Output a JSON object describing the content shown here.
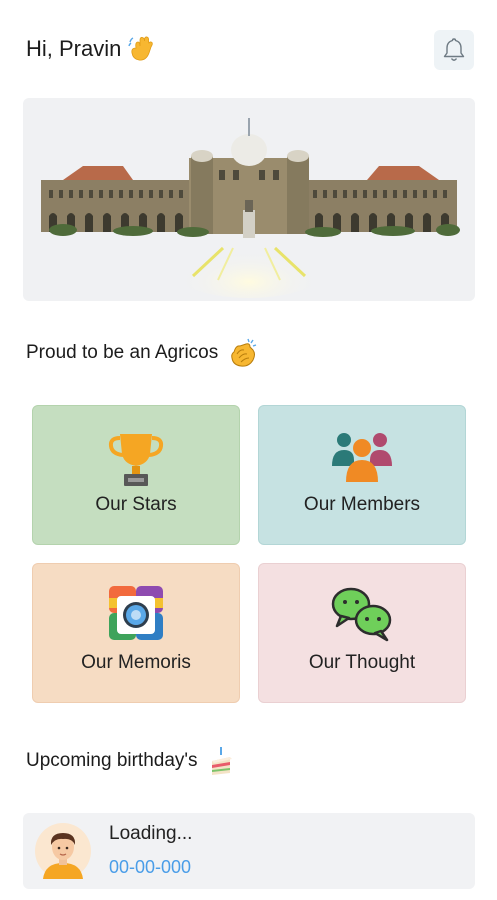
{
  "header": {
    "greeting": "Hi, Pravin",
    "greeting_icon": "waving-hand-icon",
    "notification_icon": "bell-icon"
  },
  "banner": {
    "image": "college-building-photo"
  },
  "tagline": {
    "text": "Proud to be an Agricos",
    "icon": "clapping-hands-icon"
  },
  "tiles": [
    {
      "label": "Our Stars",
      "icon": "trophy-icon",
      "color": "#c5dec0"
    },
    {
      "label": "Our Members",
      "icon": "group-members-icon",
      "color": "#c6e2e2"
    },
    {
      "label": "Our Memoris",
      "icon": "photo-gallery-icon",
      "color": "#f6dcc3"
    },
    {
      "label": "Our Thought",
      "icon": "chat-bubbles-icon",
      "color": "#f4e0e1"
    }
  ],
  "birthdays": {
    "heading": "Upcoming birthday's",
    "heading_icon": "cake-icon",
    "items": [
      {
        "name": "Loading...",
        "date": "00-00-000",
        "avatar": "user-avatar"
      }
    ]
  },
  "colors": {
    "accent_blue": "#4a9de8",
    "card_bg": "#f1f2f4"
  }
}
